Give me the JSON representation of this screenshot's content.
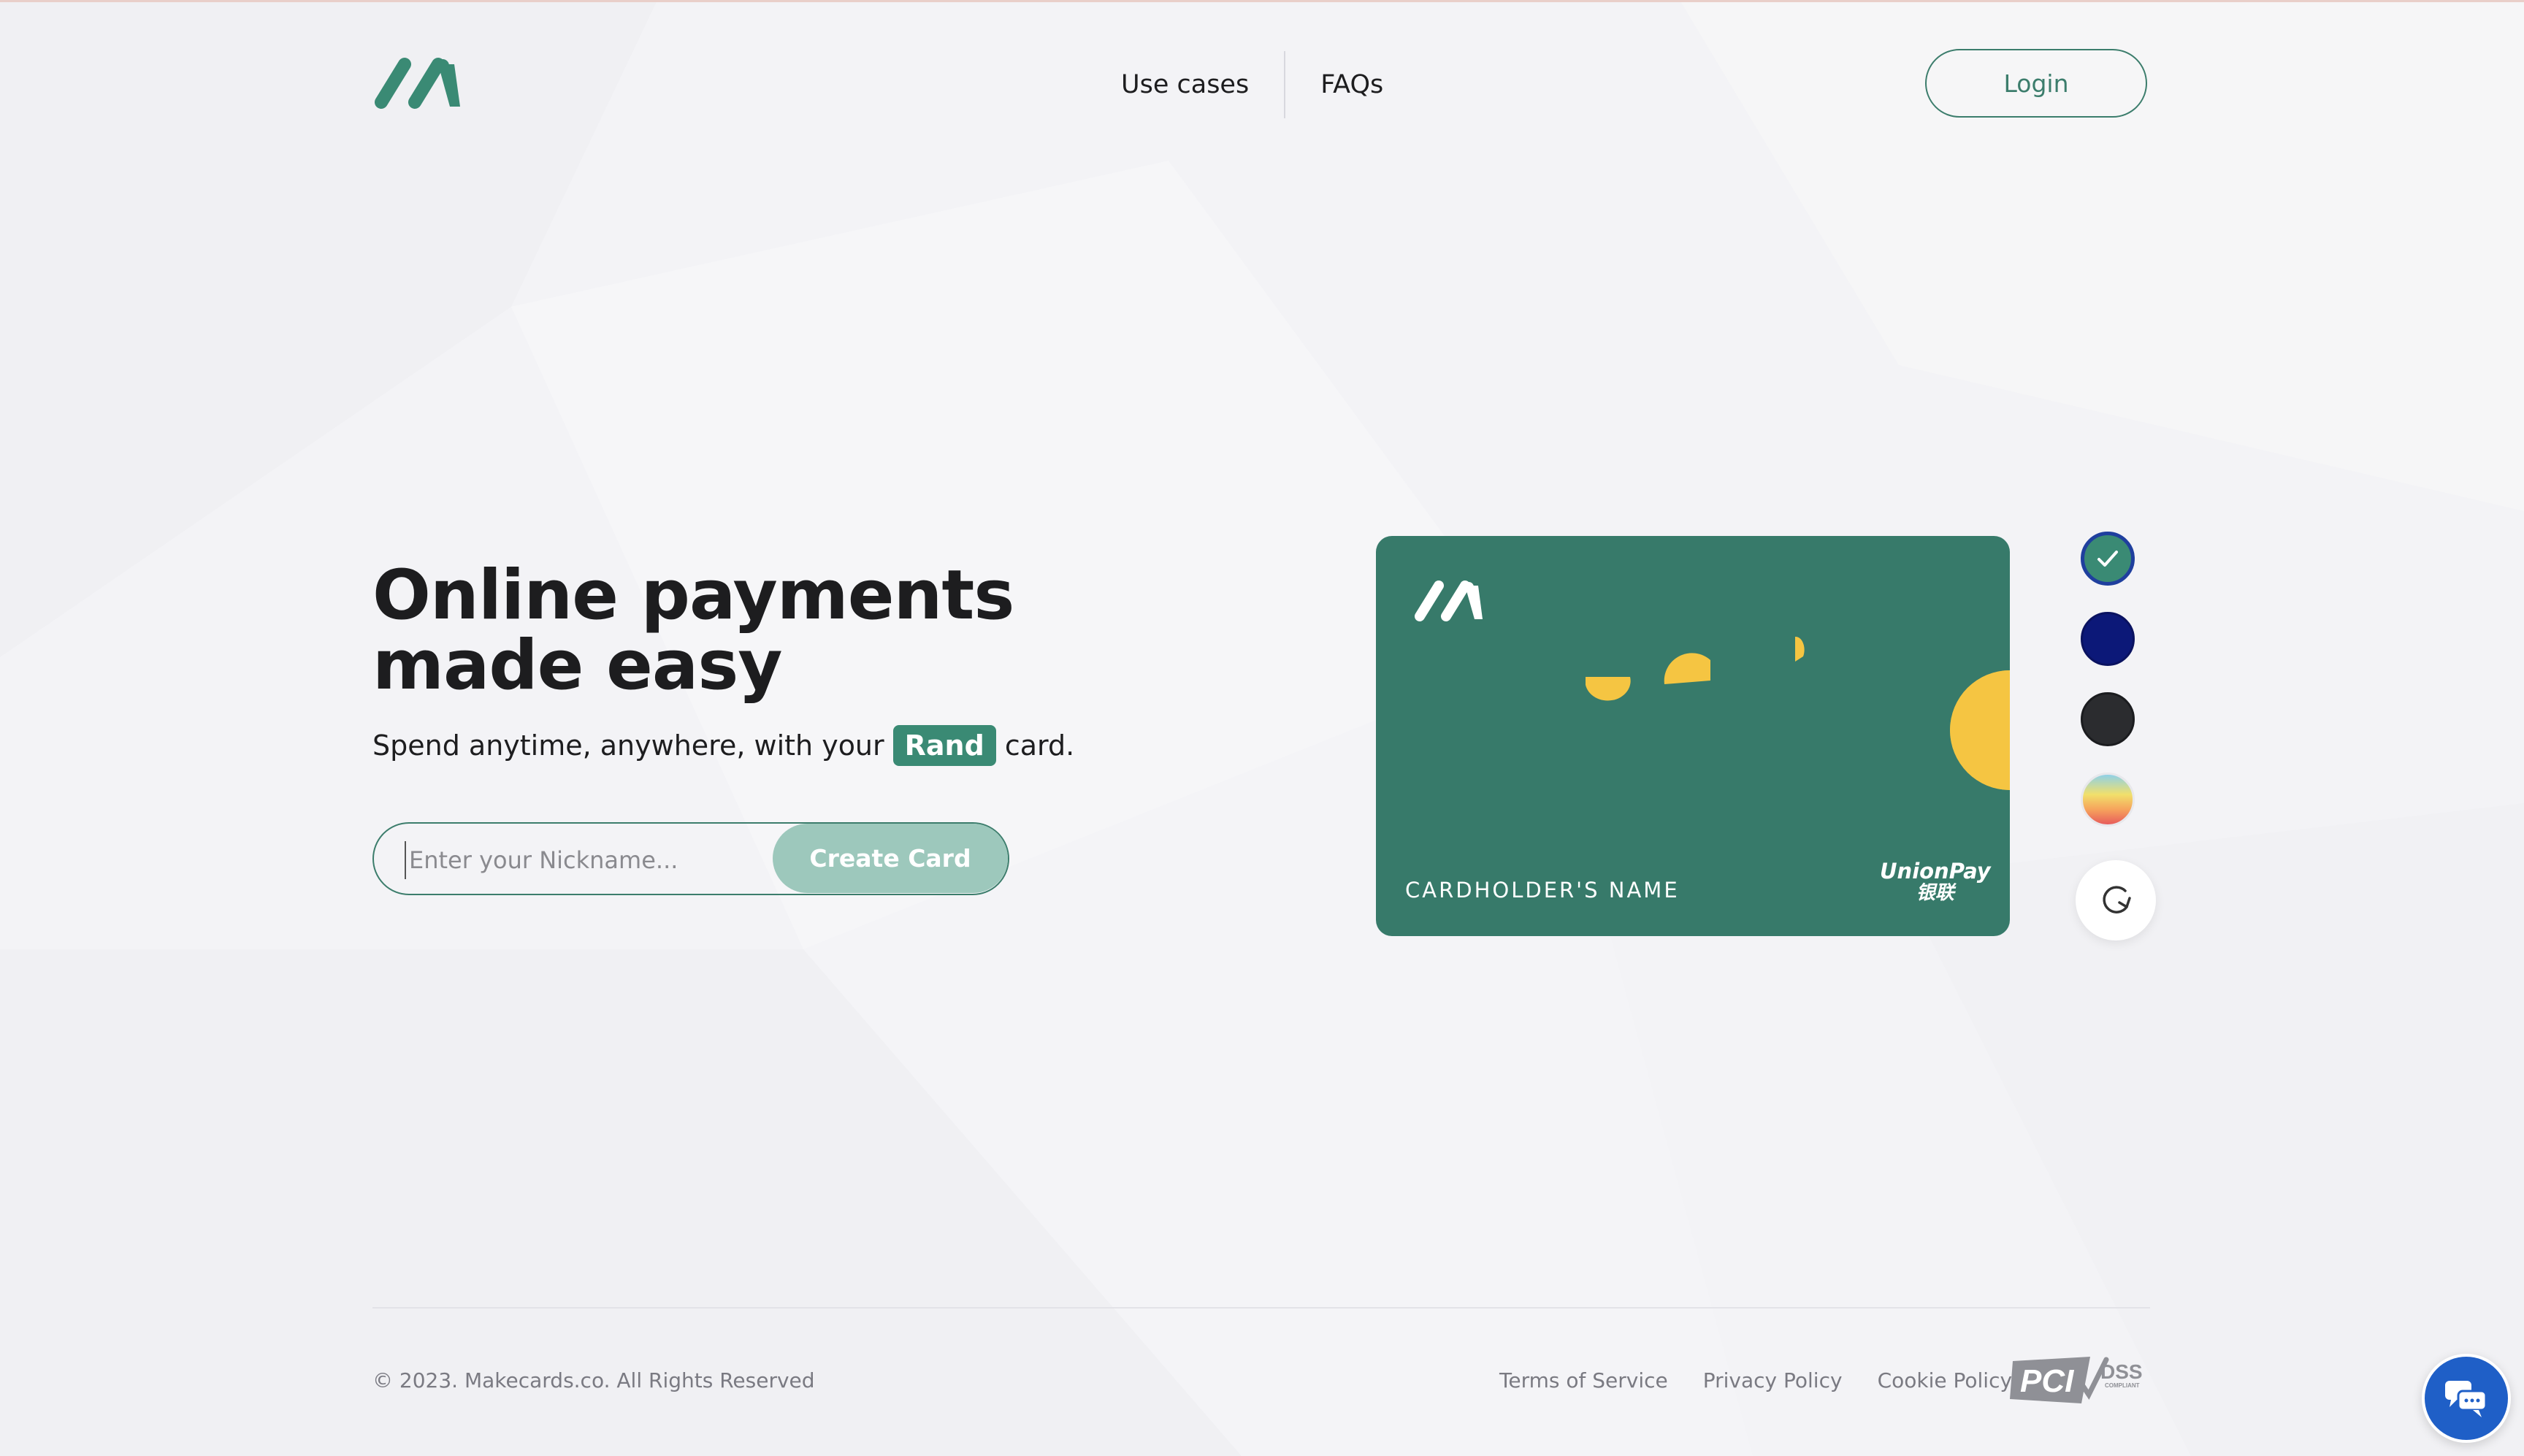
{
  "brand": {
    "logo_icon": "makecards-logo-icon",
    "accent_color": "#3a8a74",
    "card_color": "#377a6a",
    "highlight_yellow": "#f5c542"
  },
  "header": {
    "nav": [
      {
        "label": "Use cases"
      },
      {
        "label": "FAQs"
      }
    ],
    "login_label": "Login"
  },
  "hero": {
    "title_line1": "Online payments",
    "title_line2": "made easy",
    "subtitle_before": "Spend anytime, anywhere, with your",
    "currency_badge": "Rand",
    "subtitle_after": "card.",
    "nickname_placeholder": "Enter your Nickname...",
    "nickname_value": "",
    "create_button_label": "Create Card"
  },
  "card": {
    "holder_label": "CARDHOLDER'S NAME",
    "network_name": "UnionPay",
    "network_name_cn": "银联"
  },
  "color_options": [
    {
      "name": "green",
      "color": "#3a8a74",
      "selected": true
    },
    {
      "name": "navy",
      "color": "#0c1878",
      "selected": false
    },
    {
      "name": "charcoal",
      "color": "#2b2c2f",
      "selected": false
    },
    {
      "name": "rainbow",
      "color": "gradient",
      "selected": false
    }
  ],
  "refresh_icon": "refresh-icon",
  "footer": {
    "copyright": "© 2023. Makecards.co. All Rights Reserved",
    "links": [
      {
        "label": "Terms of Service"
      },
      {
        "label": "Privacy Policy"
      },
      {
        "label": "Cookie Policy"
      }
    ],
    "compliance_badge": "PCI DSS",
    "compliance_sub": "COMPLIANT"
  },
  "chat_icon": "chat-icon"
}
